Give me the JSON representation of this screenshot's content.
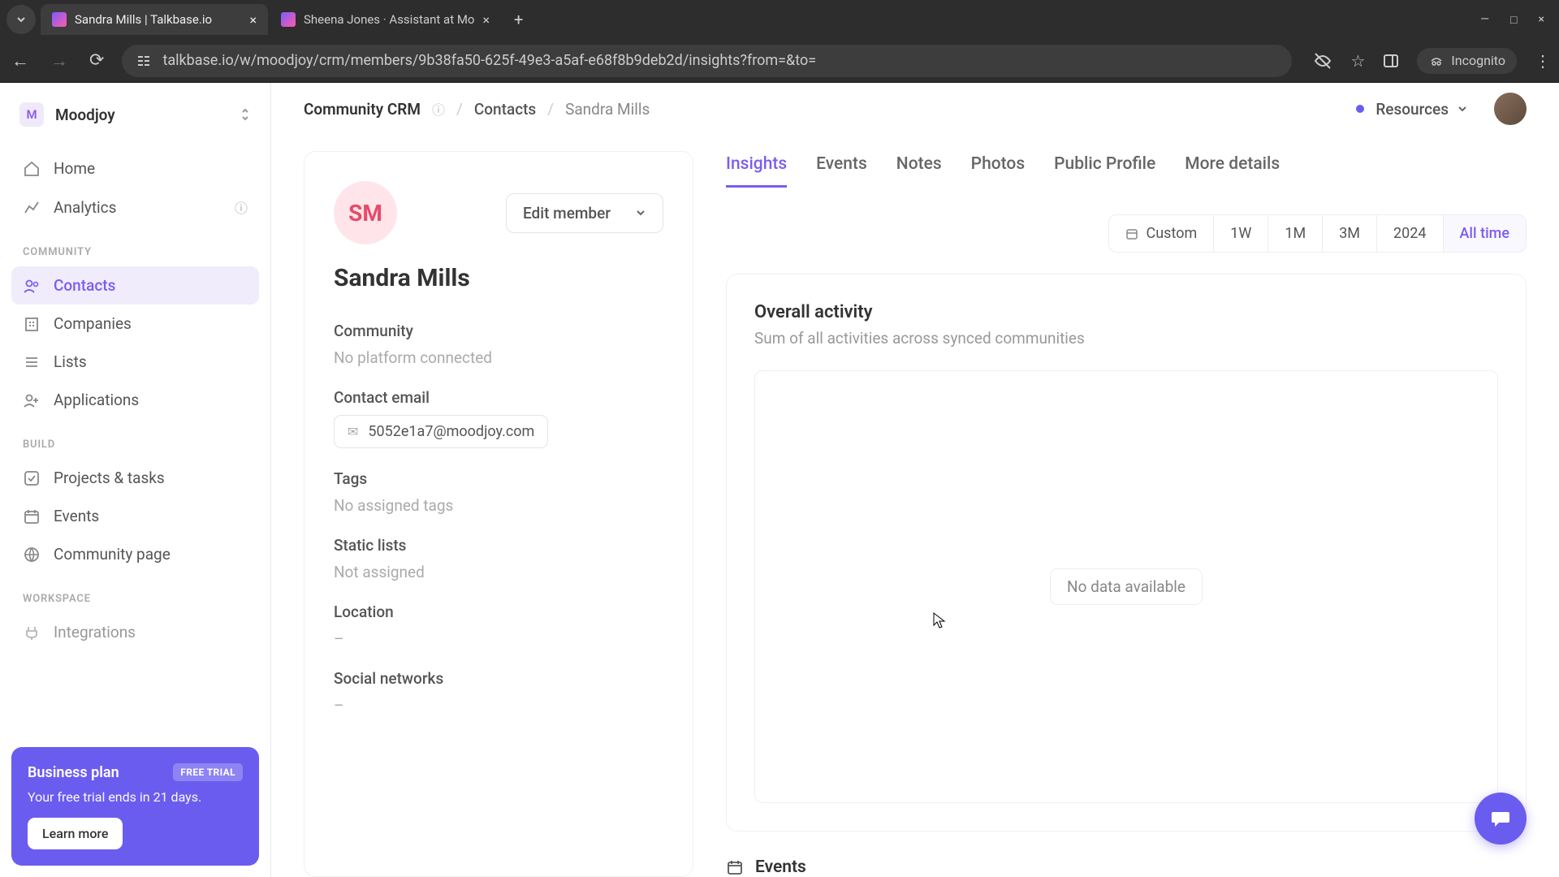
{
  "chrome": {
    "tabs": [
      {
        "title": "Sandra Mills | Talkbase.io",
        "active": true
      },
      {
        "title": "Sheena Jones · Assistant at Mo",
        "active": false
      }
    ],
    "url": "talkbase.io/w/moodjoy/crm/members/9b38fa50-625f-49e3-a5af-e68f8b9deb2d/insights?from=&to=",
    "incognito": "Incognito"
  },
  "sidebar": {
    "workspace": {
      "badge": "M",
      "name": "Moodjoy"
    },
    "items_top": [
      {
        "label": "Home"
      },
      {
        "label": "Analytics",
        "info": true
      }
    ],
    "section_community": "COMMUNITY",
    "items_community": [
      {
        "label": "Contacts",
        "active": true
      },
      {
        "label": "Companies"
      },
      {
        "label": "Lists"
      },
      {
        "label": "Applications"
      }
    ],
    "section_build": "BUILD",
    "items_build": [
      {
        "label": "Projects & tasks"
      },
      {
        "label": "Events"
      },
      {
        "label": "Community page"
      }
    ],
    "section_workspace": "WORKSPACE",
    "items_workspace": [
      {
        "label": "Integrations"
      }
    ],
    "trial": {
      "title": "Business plan",
      "badge": "FREE TRIAL",
      "subtitle": "Your free trial ends in 21 days.",
      "cta": "Learn more"
    }
  },
  "topbar": {
    "breadcrumb": [
      "Community CRM",
      "Contacts",
      "Sandra Mills"
    ],
    "resources": "Resources"
  },
  "member": {
    "initials": "SM",
    "edit_label": "Edit member",
    "name": "Sandra Mills",
    "fields": {
      "community_label": "Community",
      "community_value": "No platform connected",
      "email_label": "Contact email",
      "email_value": "5052e1a7@moodjoy.com",
      "tags_label": "Tags",
      "tags_value": "No assigned tags",
      "lists_label": "Static lists",
      "lists_value": "Not assigned",
      "location_label": "Location",
      "location_value": "–",
      "social_label": "Social networks",
      "social_value": "–"
    }
  },
  "insights": {
    "tabs": [
      "Insights",
      "Events",
      "Notes",
      "Photos",
      "Public Profile",
      "More details"
    ],
    "range": {
      "custom": "Custom",
      "buttons": [
        "1W",
        "1M",
        "3M",
        "2024",
        "All time"
      ]
    },
    "activity": {
      "title": "Overall activity",
      "subtitle": "Sum of all activities across synced communities",
      "empty": "No data available"
    },
    "events_header": "Events"
  }
}
